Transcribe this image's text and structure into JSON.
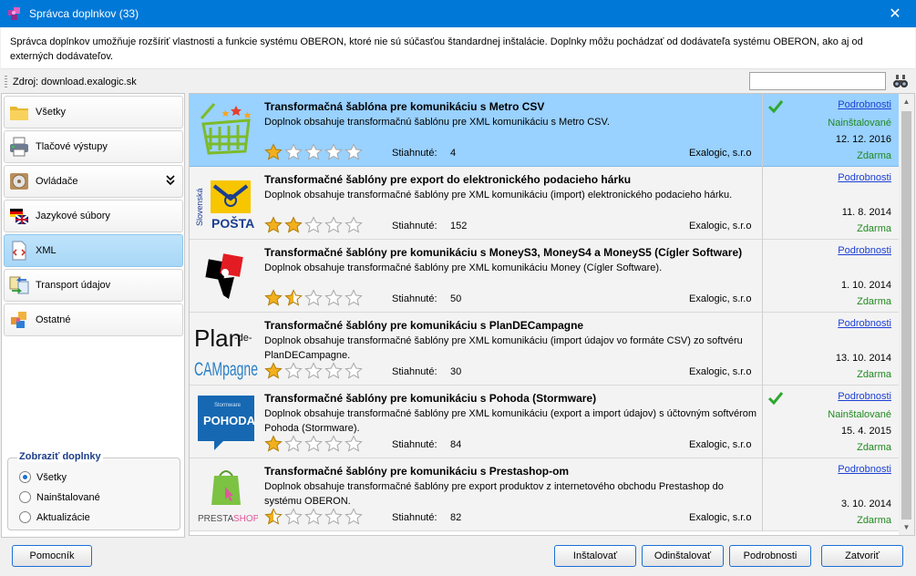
{
  "window": {
    "title": "Správca doplnkov (33)",
    "close_glyph": "✕"
  },
  "description": "Správca doplnkov umožňuje rozšíriť vlastnosti a funkcie systému OBERON, ktoré nie sú súčasťou štandardnej inštalácie. Doplnky môžu pochádzať od dodávateľa systému OBERON, ako aj od externých dodávateľov.",
  "source": {
    "label": "Zdroj: download.exalogic.sk",
    "search_value": "",
    "search_icon": "binoculars-icon"
  },
  "sidebar": {
    "items": [
      {
        "label": "Všetky",
        "icon": "folder-icon"
      },
      {
        "label": "Tlačové výstupy",
        "icon": "printer-icon"
      },
      {
        "label": "Ovládače",
        "icon": "drive-icon",
        "chevron": "»"
      },
      {
        "label": "Jazykové súbory",
        "icon": "flags-icon"
      },
      {
        "label": "XML",
        "icon": "xml-document-icon",
        "active": true
      },
      {
        "label": "Transport údajov",
        "icon": "transfer-icon"
      },
      {
        "label": "Ostatné",
        "icon": "puzzle-icon"
      }
    ]
  },
  "filter": {
    "title": "Zobraziť doplnky",
    "options": [
      {
        "label": "Všetky",
        "checked": true
      },
      {
        "label": "Nainštalované",
        "checked": false
      },
      {
        "label": "Aktualizácie",
        "checked": false
      }
    ]
  },
  "addons": [
    {
      "name": "Transformačná šablóna pre komunikáciu s Metro CSV",
      "desc": "Doplnok obsahuje transformačnú šablónu pre XML komunikáciu s Metro CSV.",
      "rating": 1,
      "downloads_label": "Stiahnuté:",
      "downloads": "4",
      "vendor": "Exalogic, s.r.o",
      "details": "Podrobnosti",
      "installed": "Nainštalované",
      "date": "12. 12. 2016",
      "price": "Zdarma",
      "is_installed": true,
      "selected": true,
      "logo": "metro-basket-logo"
    },
    {
      "name": "Transformačné šablóny pre export do elektronického podacieho hárku",
      "desc": "Doplnok obsahuje transformačné šablóny pre XML komunikáciu (import) elektronického podacieho hárku.",
      "rating": 2,
      "downloads_label": "Stiahnuté:",
      "downloads": "152",
      "vendor": "Exalogic, s.r.o",
      "details": "Podrobnosti",
      "installed": "",
      "date": "11. 8. 2014",
      "price": "Zdarma",
      "is_installed": false,
      "selected": false,
      "logo": "slovenska-posta-logo",
      "logo_text": "POŠTA",
      "logo_side": "Slovenská"
    },
    {
      "name": "Transformačné šablóny pre komunikáciu s MoneyS3, MoneyS4 a MoneyS5 (Cígler Software)",
      "desc": "Doplnok obsahuje transformačné šablóny pre XML komunikáciu Money (Cígler Software).",
      "rating": 1.5,
      "downloads_label": "Stiahnuté:",
      "downloads": "50",
      "vendor": "Exalogic, s.r.o",
      "details": "Podrobnosti",
      "installed": "",
      "date": "1. 10. 2014",
      "price": "Zdarma",
      "is_installed": false,
      "selected": false,
      "logo": "money-logo"
    },
    {
      "name": "Transformačné šablóny pre komunikáciu s PlanDECampagne",
      "desc": "Doplnok obsahuje transformačné šablóny pre XML komunikáciu (import údajov vo formáte CSV) zo softvéru PlanDECampagne.",
      "rating": 1,
      "downloads_label": "Stiahnuté:",
      "downloads": "30",
      "vendor": "Exalogic, s.r.o",
      "details": "Podrobnosti",
      "installed": "",
      "date": "13. 10. 2014",
      "price": "Zdarma",
      "is_installed": false,
      "selected": false,
      "logo": "plandecampagne-logo",
      "logo_text_1": "Plan",
      "logo_text_2": "-de-",
      "logo_text_3": "CAMpagne"
    },
    {
      "name": "Transformačné šablóny pre komunikáciu s Pohoda (Stormware)",
      "desc": "Doplnok obsahuje transformačné šablóny pre XML komunikáciu (export a import údajov) s účtovným softvérom Pohoda (Stormware).",
      "rating": 1,
      "downloads_label": "Stiahnuté:",
      "downloads": "84",
      "vendor": "Exalogic, s.r.o",
      "details": "Podrobnosti",
      "installed": "Nainštalované",
      "date": "15. 4. 2015",
      "price": "Zdarma",
      "is_installed": true,
      "selected": false,
      "logo": "pohoda-logo",
      "logo_text": "POHODA",
      "logo_small": "Stormware"
    },
    {
      "name": "Transformačné šablóny pre komunikáciu s Prestashop-om",
      "desc": "Doplnok obsahuje transformačné šablóny pre export produktov z internetového obchodu Prestashop do systému OBERON.",
      "rating": 0.5,
      "downloads_label": "Stiahnuté:",
      "downloads": "82",
      "vendor": "Exalogic, s.r.o",
      "details": "Podrobnosti",
      "installed": "",
      "date": "3. 10. 2014",
      "price": "Zdarma",
      "is_installed": false,
      "selected": false,
      "logo": "prestashop-logo",
      "logo_text_1": "PRESTA",
      "logo_text_2": "SHOP"
    }
  ],
  "buttons": {
    "help": "Pomocník",
    "install": "Inštalovať",
    "uninstall": "Odinštalovať",
    "details": "Podrobnosti",
    "close": "Zatvoriť"
  },
  "colors": {
    "titlebar": "#0078d7",
    "selected_row": "#99d1ff",
    "link": "#1c3fd4",
    "green": "#1f8a1f",
    "star": "#f2b01e"
  }
}
